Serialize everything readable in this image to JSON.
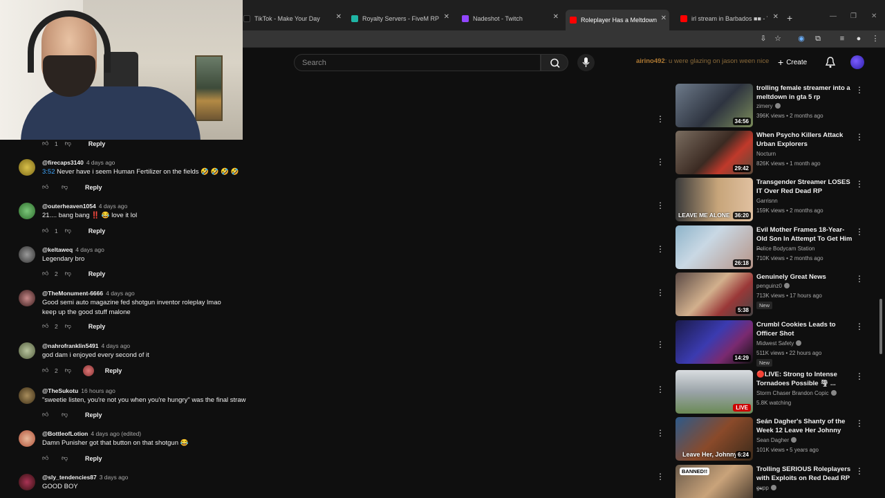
{
  "browser": {
    "tabs": [
      {
        "title": "TikTok - Make Your Day",
        "color": "#111111"
      },
      {
        "title": "Royalty Servers - FiveM RP",
        "color": "#1fb5a5"
      },
      {
        "title": "Nadeshot - Twitch",
        "color": "#9146ff"
      },
      {
        "title": "Roleplayer Has a Meltdown Ov",
        "color": "#ff0000"
      },
      {
        "title": "irl stream in Barbados ■■ - You",
        "color": "#ff0000"
      }
    ],
    "active_tab": 3
  },
  "header": {
    "search_placeholder": "Search",
    "chat_user": "airino492",
    "chat_message": ": u were glazing on jason ween nice",
    "create_label": "Create"
  },
  "comments": [
    {
      "handle": "",
      "time": "",
      "text": "",
      "likes": "1",
      "top": 0
    },
    {
      "handle": "@firecaps3140",
      "time": "4 days ago",
      "timestamp": "3:52",
      "text": " Never have i seem Human Fertilizer on the fields 🤣 🤣 🤣 🤣",
      "likes": ""
    },
    {
      "handle": "@outerheaven1054",
      "time": "4 days ago",
      "text": "21.... bang bang ‼️ 😂 love it lol",
      "likes": "1"
    },
    {
      "handle": "@keltaweq",
      "time": "4 days ago",
      "text": "Legendary bro",
      "likes": "2"
    },
    {
      "handle": "@TheMonument-6666",
      "time": "4 days ago",
      "text": "Good semi auto magazine fed shotgun inventor roleplay lmao",
      "text2": "keep up the good stuff malone",
      "likes": "2"
    },
    {
      "handle": "@nahrofranklin5491",
      "time": "4 days ago",
      "text": "god dam i enjoyed every second of it",
      "likes": "2"
    },
    {
      "handle": "@TheSukotu",
      "time": "16 hours ago",
      "text": "\"sweetie listen, you're not you when you're hungry\" was the final straw",
      "likes": ""
    },
    {
      "handle": "@BottleofLotion",
      "time": "4 days ago (edited)",
      "text": "Damn Punisher got that button on that shotgun 😂",
      "likes": ""
    },
    {
      "handle": "@sly_tendencies87",
      "time": "3 days ago",
      "text": "GOOD BOY",
      "likes": ""
    }
  ],
  "reply_label": "Reply",
  "recommendations": [
    {
      "title": "trolling female streamer into a meltdown in gta 5 rp",
      "channel": "zimery",
      "verified": true,
      "views": "396K views • 2 months ago",
      "duration": "34:56",
      "new": false
    },
    {
      "title": "When Psycho Killers Attack Urban Explorers",
      "channel": "Nocturn",
      "verified": false,
      "views": "826K views • 1 month ago",
      "duration": "29:42",
      "new": false
    },
    {
      "title": "Transgender Streamer LOSES IT Over Red Dead RP",
      "channel": "Garrisnn",
      "verified": false,
      "views": "159K views • 2 months ago",
      "duration": "36:20",
      "new": false,
      "thumb_text": "LEAVE ME ALONE"
    },
    {
      "title": "Evil Mother Frames 18-Year-Old Son In Attempt To Get Him ...",
      "channel": "Police Bodycam Station",
      "verified": false,
      "views": "710K views • 2 months ago",
      "duration": "26:18",
      "new": false
    },
    {
      "title": "Genuinely Great News",
      "channel": "penguinz0",
      "verified": true,
      "views": "713K views • 17 hours ago",
      "duration": "5:38",
      "new": true
    },
    {
      "title": "Crumbl Cookies Leads to Officer Shot",
      "channel": "Midwest Safety",
      "verified": true,
      "views": "511K views • 22 hours ago",
      "duration": "14:29",
      "new": true
    },
    {
      "title": "🔴LIVE: Strong to Intense Tornadoes Possible 🌪 ...",
      "channel": "Storm Chaser Brandon Copic",
      "verified": true,
      "views": "5.8K watching",
      "duration": "LIVE",
      "live": true,
      "new": false
    },
    {
      "title": "Seán Dagher's Shanty of the Week 12 Leave Her Johnny",
      "channel": "Sean Dagher",
      "verified": true,
      "views": "101K views • 5 years ago",
      "duration": "6:24",
      "new": false,
      "thumb_text": "Leave Her, Johnny"
    },
    {
      "title": "Trolling SERIOUS Roleplayers with Exploits on Red Dead RP ...",
      "channel": "gupp",
      "verified": true,
      "views": "",
      "duration": "",
      "new": false,
      "thumb_text": "BANNED!!"
    }
  ],
  "new_label": "New",
  "colors": {
    "accent": "#ff0000",
    "link": "#3ea6ff",
    "bg": "#0f0f0f"
  }
}
